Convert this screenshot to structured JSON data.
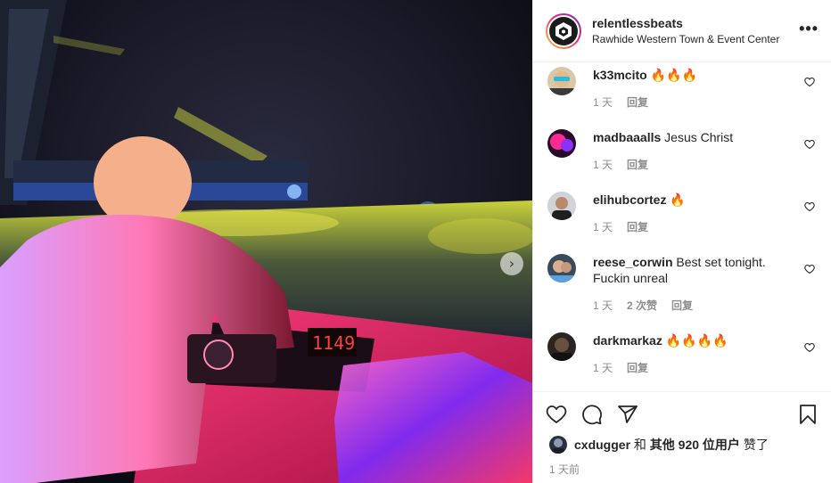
{
  "post": {
    "username": "relentlessbeats",
    "location": "Rawhide Western Town & Event Center",
    "more_label": "•••",
    "next_arrow": "›"
  },
  "comments": [
    {
      "user": "k33mcito",
      "text": "🔥🔥🔥",
      "time": "1 天",
      "likes": "",
      "reply": "回复"
    },
    {
      "user": "madbaaalls",
      "text": "Jesus Christ",
      "time": "1 天",
      "likes": "",
      "reply": "回复"
    },
    {
      "user": "elihubcortez",
      "text": "🔥",
      "time": "1 天",
      "likes": "",
      "reply": "回复"
    },
    {
      "user": "reese_corwin",
      "text": "Best set tonight. Fuckin unreal",
      "time": "1 天",
      "likes": "2 次赞",
      "reply": "回复"
    },
    {
      "user": "darkmarkaz",
      "text": "🔥🔥🔥🔥",
      "time": "1 天",
      "likes": "",
      "reply": "回复"
    }
  ],
  "likes_line": {
    "user": "cxdugger",
    "middle": " 和 ",
    "others": "其他 920 位用户",
    "suffix": " 赞了"
  },
  "posted_time": "1 天前",
  "icons": {
    "like": "heart-icon",
    "comment": "comment-icon",
    "share": "paper-plane-icon",
    "save": "bookmark-icon",
    "comment_like": "heart-icon",
    "menu": "more-icon",
    "next": "chevron-right-icon"
  },
  "colors": {
    "text": "#262626",
    "muted": "#8e8e8e",
    "border": "#efefef",
    "ring_start": "#f9ce34",
    "ring_mid": "#ee2a7b",
    "ring_end": "#6228d7"
  }
}
